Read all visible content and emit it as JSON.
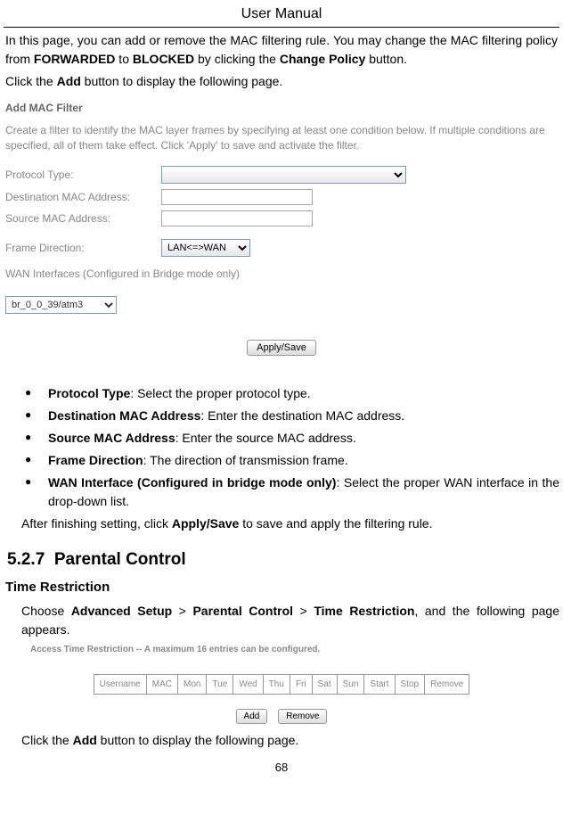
{
  "header": {
    "title": "User Manual"
  },
  "intro": {
    "text1_pre": "In this page, you can add or remove the MAC filtering rule. You may change the MAC filtering policy from ",
    "forwarded": "FORWARDED",
    "text1_mid": " to ",
    "blocked": "BLOCKED",
    "text1_mid2": " by clicking the ",
    "change_policy": "Change Policy",
    "text1_end": " button.",
    "text2_pre": "Click the ",
    "add": "Add",
    "text2_end": " button to display the following page."
  },
  "form": {
    "title": "Add MAC Filter",
    "description": "Create a filter to identify the MAC layer frames by specifying at least one condition below. If multiple conditions are specified, all of them take effect. Click 'Apply' to save and activate the filter.",
    "protocol_label": "Protocol Type:",
    "dest_mac_label": "Destination MAC Address:",
    "src_mac_label": "Source MAC Address:",
    "frame_dir_label": "Frame Direction:",
    "frame_dir_value": "LAN<=>WAN",
    "wan_label": "WAN Interfaces (Configured in Bridge mode only)",
    "interface_value": "br_0_0_39/atm3",
    "apply_save": "Apply/Save"
  },
  "bullets": {
    "b1_label": "Protocol Type",
    "b1_text": ": Select the proper protocol type.",
    "b2_label": "Destination MAC Address",
    "b2_text": ": Enter the destination MAC address.",
    "b3_label": "Source MAC Address",
    "b3_text": ": Enter the source MAC address.",
    "b4_label": "Frame Direction",
    "b4_text": ": The direction of transmission frame.",
    "b5_label": "WAN Interface (Configured in bridge mode only)",
    "b5_text": ": Select the proper WAN interface in the drop-down list."
  },
  "after_text": {
    "pre": "After finishing setting, click ",
    "bold": "Apply/Save",
    "post": " to save and apply the filtering rule."
  },
  "section": {
    "number": "5.2.7",
    "title": "Parental Control",
    "subtitle": "Time Restriction",
    "desc_pre": "Choose ",
    "desc_path1": "Advanced Setup",
    "desc_gt1": " > ",
    "desc_path2": "Parental Control",
    "desc_gt2": " > ",
    "desc_path3": "Time Restriction",
    "desc_post": ", and the following page appears."
  },
  "restriction": {
    "title": "Access Time Restriction -- A maximum 16 entries can be configured.",
    "headers": [
      "Username",
      "MAC",
      "Mon",
      "Tue",
      "Wed",
      "Thu",
      "Fri",
      "Sat",
      "Sun",
      "Start",
      "Stop",
      "Remove"
    ],
    "add_btn": "Add",
    "remove_btn": "Remove"
  },
  "closing": {
    "pre": "Click the ",
    "bold": "Add",
    "post": " button to display the following page."
  },
  "page_number": "68"
}
